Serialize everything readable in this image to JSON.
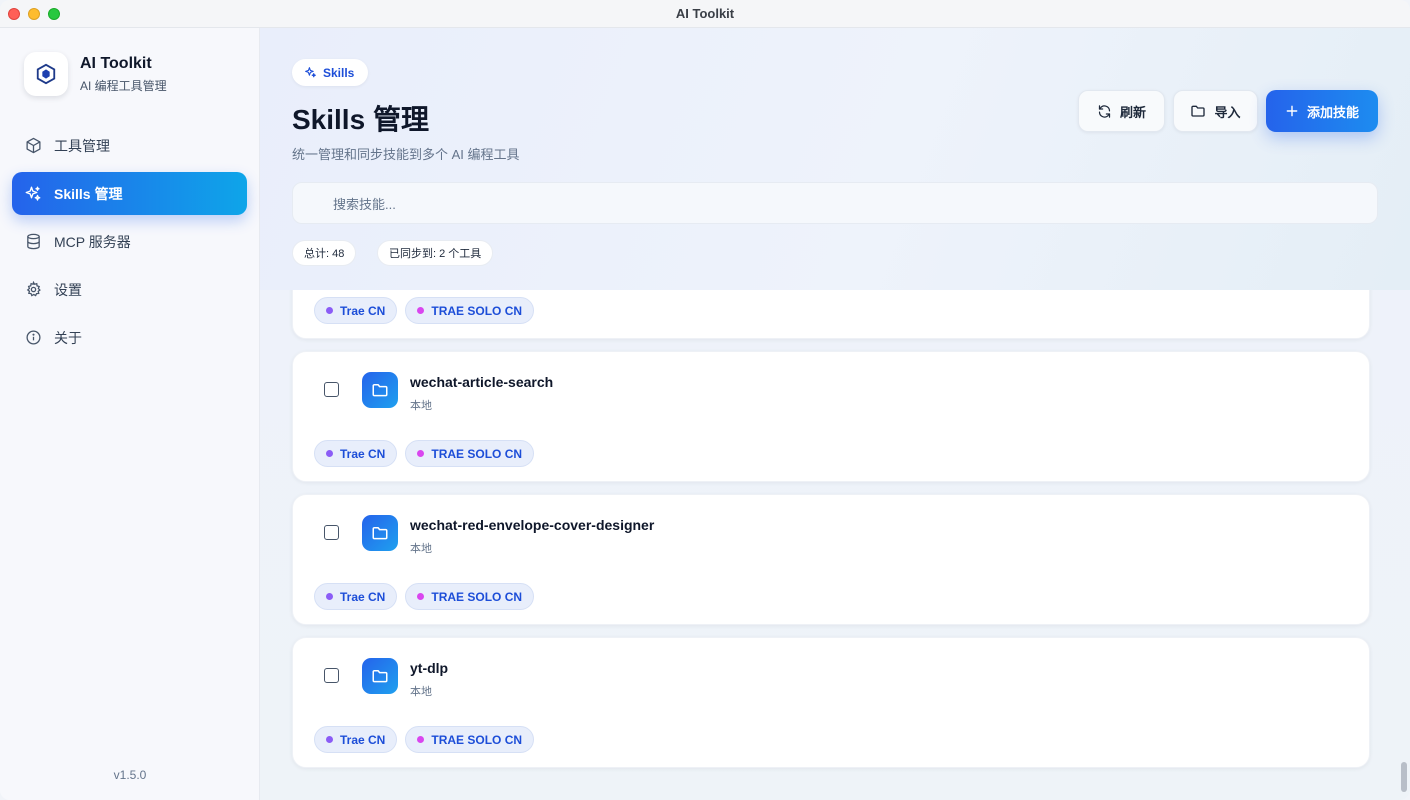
{
  "window": {
    "title": "AI Toolkit"
  },
  "brand": {
    "name": "AI Toolkit",
    "subtitle": "AI 编程工具管理"
  },
  "nav": [
    {
      "label": "工具管理",
      "icon": "box-icon"
    },
    {
      "label": "Skills 管理",
      "icon": "sparkles-icon",
      "active": true
    },
    {
      "label": "MCP 服务器",
      "icon": "database-icon"
    },
    {
      "label": "设置",
      "icon": "gear-icon"
    },
    {
      "label": "关于",
      "icon": "info-icon"
    }
  ],
  "version": "v1.5.0",
  "header": {
    "pill": "Skills",
    "title": "Skills 管理",
    "subtitle": "统一管理和同步技能到多个 AI 编程工具",
    "refresh_label": "刷新",
    "import_label": "导入",
    "add_label": "添加技能"
  },
  "search": {
    "placeholder": "搜索技能..."
  },
  "stats": {
    "total": "总计: 48",
    "synced": "已同步到: 2 个工具"
  },
  "colors": {
    "accent": "#2563eb",
    "trae_dot": "#8b5cf6",
    "solo_dot": "#d946ef"
  },
  "tag_labels": {
    "trae": "Trae CN",
    "solo": "TRAE SOLO CN"
  },
  "skills": [
    {
      "name": "",
      "source": "",
      "tags": [
        "Trae CN",
        "TRAE SOLO CN"
      ]
    },
    {
      "name": "wechat-article-search",
      "source": "本地",
      "tags": [
        "Trae CN",
        "TRAE SOLO CN"
      ]
    },
    {
      "name": "wechat-red-envelope-cover-designer",
      "source": "本地",
      "tags": [
        "Trae CN",
        "TRAE SOLO CN"
      ]
    },
    {
      "name": "yt-dlp",
      "source": "本地",
      "tags": [
        "Trae CN",
        "TRAE SOLO CN"
      ]
    }
  ]
}
